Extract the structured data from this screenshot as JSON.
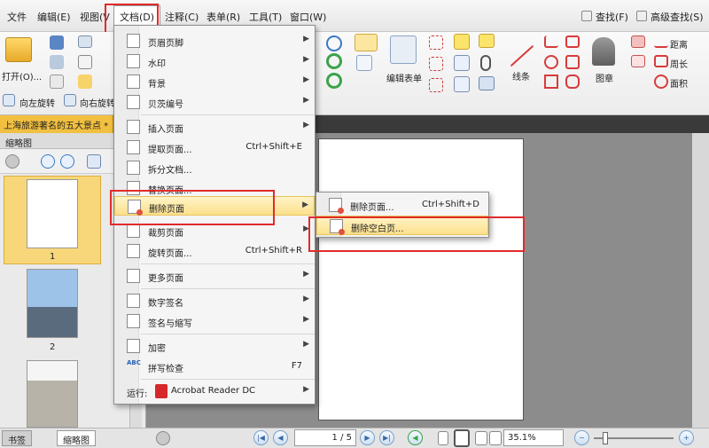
{
  "menubar": {
    "items": [
      "文件",
      "编辑(E)",
      "视图(V",
      "文档(D)",
      "注释(C)",
      "表单(R)",
      "工具(T)",
      "窗口(W)"
    ],
    "find": "查找(F)",
    "advanced_find": "高级查找(S)"
  },
  "ribbon": {
    "open_label": "打开(O)...",
    "rotate_left": "向左旋转",
    "rotate_right": "向右旋转",
    "edit_form": "编辑表单",
    "line": "线条",
    "stamp": "图章",
    "distance": "距离",
    "perimeter": "周长",
    "area": "面积",
    "spell_icon": "ABC"
  },
  "doc_tab": {
    "title": "上海旅游著名的五大景点 *"
  },
  "left_panel": {
    "title": "缩略图",
    "thumbnails": [
      {
        "num": "1"
      },
      {
        "num": "2"
      }
    ]
  },
  "document_menu": {
    "items": [
      {
        "label": "页眉页脚",
        "icon": "header-footer-icon",
        "has_arrow": true
      },
      {
        "label": "水印",
        "icon": "watermark-icon",
        "has_arrow": true
      },
      {
        "label": "背景",
        "icon": "background-icon",
        "has_arrow": true
      },
      {
        "label": "贝茨编号",
        "icon": "bates-number-icon",
        "has_arrow": true
      },
      {
        "label": "插入页面",
        "icon": "insert-page-icon",
        "has_arrow": true
      },
      {
        "label": "提取页面...",
        "shortcut": "Ctrl+Shift+E",
        "icon": "extract-page-icon"
      },
      {
        "label": "拆分文档...",
        "icon": "split-document-icon"
      },
      {
        "label": "替换页面...",
        "icon": "replace-page-icon"
      },
      {
        "label": "删除页面",
        "icon": "delete-page-icon",
        "has_arrow": true
      },
      {
        "label": "裁剪页面",
        "icon": "crop-page-icon",
        "has_arrow": true
      },
      {
        "label": "旋转页面...",
        "shortcut": "Ctrl+Shift+R",
        "icon": "rotate-page-icon"
      },
      {
        "label": "更多页面",
        "icon": "more-pages-icon",
        "has_arrow": true
      },
      {
        "label": "数字签名",
        "icon": "digital-signature-icon",
        "has_arrow": true
      },
      {
        "label": "签名与缩写",
        "icon": "sign-initial-icon",
        "has_arrow": true
      },
      {
        "label": "加密",
        "icon": "encrypt-icon",
        "has_arrow": true
      },
      {
        "label": "拼写检查",
        "shortcut": "F7",
        "icon": "spell-check-icon"
      },
      {
        "label": "运行:",
        "app": "Acrobat Reader DC",
        "icon": "acrobat-icon",
        "has_arrow": true
      }
    ]
  },
  "delete_submenu": {
    "items": [
      {
        "label": "删除页面...",
        "shortcut": "Ctrl+Shift+D"
      },
      {
        "label": "删除空白页..."
      }
    ]
  },
  "statusbar": {
    "tabs": [
      "书签",
      "缩略图"
    ],
    "page_display": "1 / 5",
    "zoom": "35.1%"
  },
  "colors": {
    "highlight_red": "#e12b2b",
    "tab_gold": "#f2c040",
    "menu_hover": "#fce08c"
  }
}
